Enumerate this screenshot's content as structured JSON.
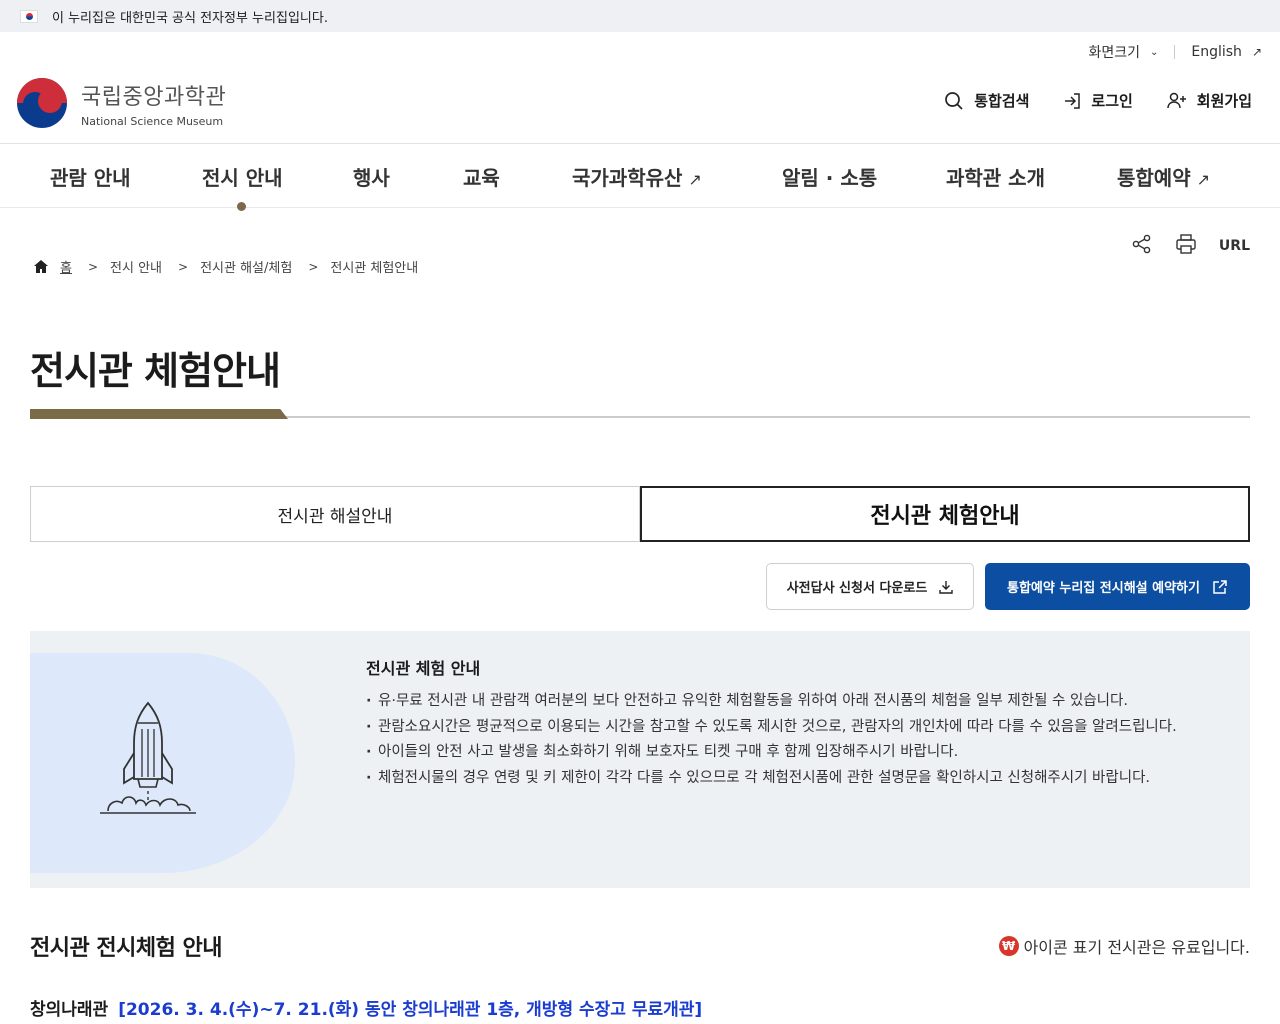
{
  "gov_banner": {
    "text": "이 누리집은 대한민국 공식 전자정부 누리집입니다."
  },
  "utility": {
    "font_size": "화면크기",
    "english": "English"
  },
  "logo": {
    "ko": "국립중앙과학관",
    "en": "National Science Museum"
  },
  "header_actions": {
    "search": "통합검색",
    "login": "로그인",
    "signup": "회원가입"
  },
  "gnb": {
    "items": [
      {
        "label": "관람 안내",
        "external": false
      },
      {
        "label": "전시 안내",
        "external": false,
        "active": true
      },
      {
        "label": "행사",
        "external": false
      },
      {
        "label": "교육",
        "external": false
      },
      {
        "label": "국가과학유산",
        "external": true
      },
      {
        "label": "알림 · 소통",
        "external": false
      },
      {
        "label": "과학관 소개",
        "external": false
      },
      {
        "label": "통합예약",
        "external": true
      }
    ]
  },
  "tools": {
    "url": "URL"
  },
  "breadcrumb": {
    "home": "홈",
    "level1": "전시 안내",
    "level2": "전시관 해설/체험",
    "current": "전시관 체험안내"
  },
  "page": {
    "title": "전시관 체험안내"
  },
  "tabs": [
    {
      "label": "전시관 해설안내",
      "active": false
    },
    {
      "label": "전시관 체험안내",
      "active": true
    }
  ],
  "buttons": {
    "download": "사전답사 신청서 다운로드",
    "reserve": "통합예약 누리집 전시해설 예약하기"
  },
  "info": {
    "title": "전시관 체험 안내",
    "items": [
      "유·무료 전시관 내 관람객 여러분의 보다 안전하고 유익한 체험활동을 위하여 아래 전시품의 체험을 일부 제한될 수 있습니다.",
      "관람소요시간은 평균적으로 이용되는 시간을 참고할 수 있도록 제시한 것으로, 관람자의 개인차에 따라 다를 수 있음을 알려드립니다.",
      "아이들의 안전 사고 발생을 최소화하기 위해 보호자도 티켓 구매 후 함께 입장해주시기 바랍니다.",
      "체험전시물의 경우 연령 및 키 제한이 각각 다를 수 있으므로 각 체험전시품에 관한 설명문을 확인하시고 신청해주시기 바랍니다."
    ]
  },
  "section": {
    "title": "전시관 전시체험 안내",
    "paid_icon": "₩",
    "paid_note": "아이콘 표기 전시관은 유료입니다.",
    "hall": "창의나래관",
    "hall_period": "[2026. 3. 4.(수)~7. 21.(화) 동안 창의나래관 1층, 개방형 수장고 무료개관]"
  },
  "colors": {
    "accent_brown": "#7b6a47",
    "primary_blue": "#0c4ea2",
    "link_blue": "#1a3cd0",
    "paid_red": "#d9352a"
  },
  "icons": {
    "search": "search-icon",
    "login": "login-icon",
    "signup": "user-plus-icon",
    "share": "share-icon",
    "print": "print-icon",
    "external": "external-link-icon",
    "download": "download-icon",
    "home": "home-icon"
  }
}
